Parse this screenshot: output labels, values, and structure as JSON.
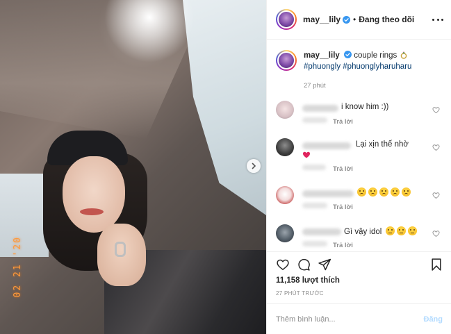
{
  "post": {
    "photo": {
      "datestamp": "02 21 '20",
      "next_icon": "chevron-right-icon"
    },
    "header": {
      "username": "may__lily",
      "separator": "•",
      "follow_label": "Đang theo dõi",
      "more_icon": "more-options-icon"
    },
    "caption": {
      "username": "may__lily",
      "text": "couple rings",
      "hashtags": [
        "#phuongly",
        "#phuonglyharuharu"
      ],
      "time": "27 phút"
    },
    "comments": [
      {
        "text": "i know him :))",
        "reply_label": "Trả lời"
      },
      {
        "text": "Lại xịn thế nhờ",
        "reply_label": "Trả lời"
      },
      {
        "text": "",
        "reply_label": "Trả lời"
      },
      {
        "text": "Gì vậy idol",
        "reply_label": "Trả lời"
      }
    ],
    "actions": {
      "likes": "11,158 lượt thích",
      "time_ago": "27 PHÚT TRƯỚC"
    },
    "add_comment": {
      "placeholder": "Thêm bình luận...",
      "post_label": "Đăng"
    },
    "colors": {
      "link": "#00376b",
      "verified": "#3897f0",
      "muted": "#8e8e8e",
      "post_disabled": "#b3dbff",
      "heart": "#ed4956"
    }
  }
}
